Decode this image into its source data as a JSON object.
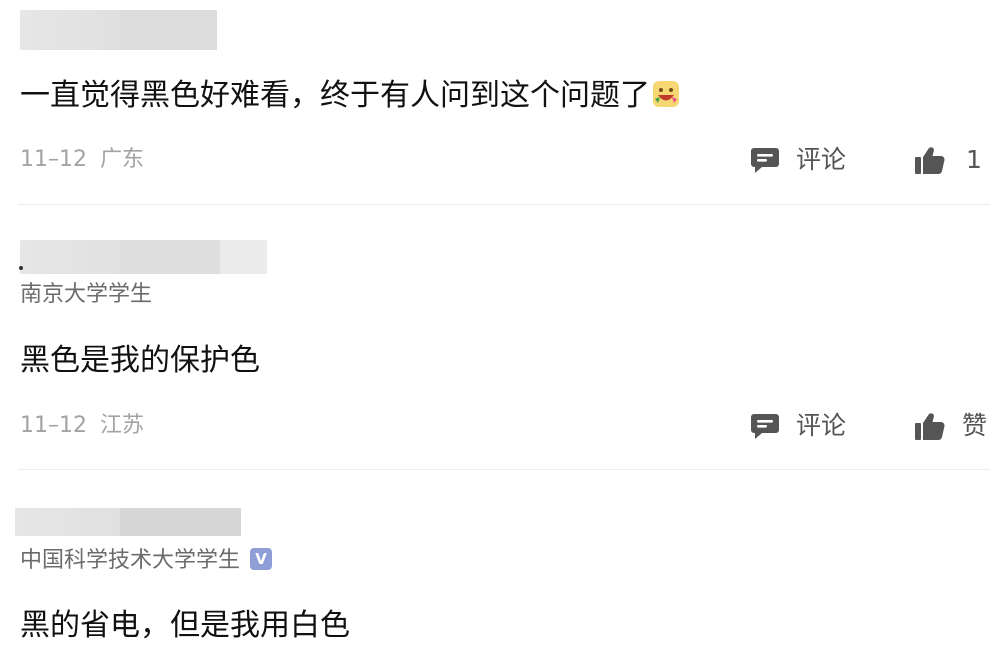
{
  "comments": [
    {
      "subtitle": "",
      "text": "一直觉得黑色好难看，终于有人问到这个问题了",
      "emoji": "laughing-emoji",
      "date": "11–12",
      "region": "广东",
      "comment_label": "评论",
      "like_label": "1"
    },
    {
      "subtitle": "南京大学学生",
      "text": "黑色是我的保护色",
      "date": "11–12",
      "region": "江苏",
      "comment_label": "评论",
      "like_label": "赞"
    },
    {
      "subtitle": "中国科学技术大学学生",
      "verified_badge": "V",
      "text": "黑的省电，但是我用白色"
    }
  ],
  "colors": {
    "text": "#111111",
    "meta": "#a3a3a3",
    "action": "#555555",
    "badge": "#8f9ed6",
    "divider": "#ececec"
  }
}
